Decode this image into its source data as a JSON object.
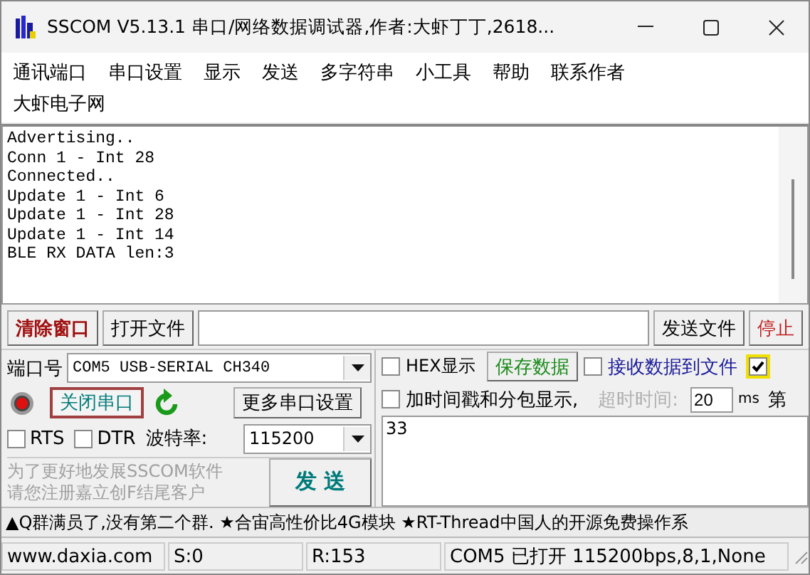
{
  "window": {
    "title": "SSCOM V5.13.1 串口/网络数据调试器,作者:大虾丁丁,2618..."
  },
  "menu_rows": [
    [
      "通讯端口",
      "串口设置",
      "显示",
      "发送",
      "多字符串",
      "小工具",
      "帮助",
      "联系作者"
    ],
    [
      "大虾电子网"
    ]
  ],
  "receive_log": [
    "Advertising..",
    "Conn 1 - Int 28",
    "Connected..",
    "Update 1 - Int 6",
    "Update 1 - Int 28",
    "Update 1 - Int 14",
    "BLE RX DATA len:3"
  ],
  "toolbar": {
    "clear_button": "清除窗口",
    "open_file_button": "打开文件",
    "send_file_button": "发送文件",
    "stop_button": "停止"
  },
  "port": {
    "label": "端口号",
    "value": "COM5 USB-SERIAL CH340"
  },
  "open_button": {
    "label": "关闭串口",
    "on": true
  },
  "more_settings_button": "更多串口设置",
  "rts": {
    "label": "RTS",
    "checked": false
  },
  "dtr": {
    "label": "DTR",
    "checked": false
  },
  "baud": {
    "label": "波特率:",
    "value": "115200"
  },
  "promo_text": [
    "为了更好地发展SSCOM软件",
    "请您注册嘉立创F结尾客户"
  ],
  "send_button": "发 送",
  "hex_display": {
    "label": "HEX显示",
    "checked": false
  },
  "save_button": "保存数据",
  "receive_to_file": {
    "label": "接收数据到文件",
    "checked": false
  },
  "cut_checkbox": {
    "checked": true
  },
  "timestamp": {
    "label": "加时间戳和分包显示,",
    "checked": false
  },
  "timeout": {
    "label": "超时时间:",
    "value": "20",
    "unit": "ms",
    "disabled": true
  },
  "cut_label": "第",
  "send_text": "33",
  "ticker": "▲Q群满员了,没有第二个群. ★合宙高性价比4G模块 ★RT-Thread中国人的开源免费操作系",
  "status_bar": [
    "www.daxia.com",
    "S:0",
    "R:153",
    "COM5 已打开  115200bps,8,1,None"
  ]
}
